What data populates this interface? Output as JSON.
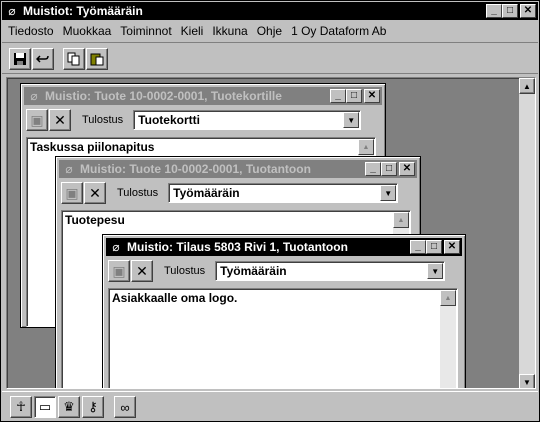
{
  "app": {
    "title": "Muistiot: Työmääräin"
  },
  "window_buttons": {
    "minimize": "_",
    "maximize": "□",
    "close": "✕"
  },
  "menu": [
    {
      "label": "Tiedosto"
    },
    {
      "label": "Muokkaa"
    },
    {
      "label": "Toiminnot"
    },
    {
      "label": "Kieli"
    },
    {
      "label": "Ikkuna"
    },
    {
      "label": "Ohje"
    },
    {
      "label": "1 Oy Dataform Ab"
    }
  ],
  "toolbar": {
    "save_icon": "save-icon",
    "undo_icon": "undo-icon",
    "copy_icon": "copy-icon",
    "paste_icon": "paste-icon"
  },
  "windows": [
    {
      "title": "Muistio: Tuote 10-0002-0001, Tuotekortille",
      "print_label": "Tulostus",
      "print_value": "Tuotekortti",
      "memo_text": "Taskussa piilonapitus"
    },
    {
      "title": "Muistio: Tuote 10-0002-0001, Tuotantoon",
      "print_label": "Tulostus",
      "print_value": "Työmääräin",
      "memo_text": "Tuotepesu"
    },
    {
      "title": "Muistio: Tilaus 5803 Rivi 1, Tuotantoon",
      "print_label": "Tulostus",
      "print_value": "Työmääräin",
      "memo_text": "Asiakkaalle oma logo."
    }
  ],
  "bottom_toolbar": [
    {
      "icon": "person-icon"
    },
    {
      "icon": "note-icon"
    },
    {
      "icon": "trash-icon"
    },
    {
      "icon": "key-icon"
    },
    {
      "icon": "binoculars-icon"
    }
  ]
}
